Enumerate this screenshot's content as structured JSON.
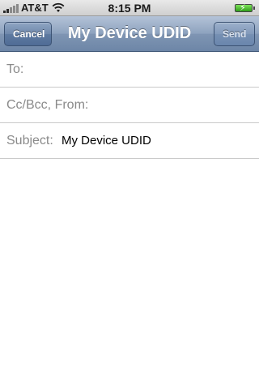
{
  "status_bar": {
    "carrier": "AT&T",
    "time": "8:15 PM",
    "signal_icon": "signal-bars-icon",
    "wifi_icon": "wifi-icon",
    "battery_icon": "battery-charging-icon"
  },
  "nav": {
    "title": "My Device UDID",
    "cancel_label": "Cancel",
    "send_label": "Send"
  },
  "fields": {
    "to_label": "To:",
    "cc_label": "Cc/Bcc, From:",
    "subject_label": "Subject:",
    "subject_value": "My Device UDID"
  },
  "colors": {
    "nav_bar": "#7f95b3",
    "label_gray": "#8a8a8a",
    "battery_green": "#2f9e1a"
  }
}
